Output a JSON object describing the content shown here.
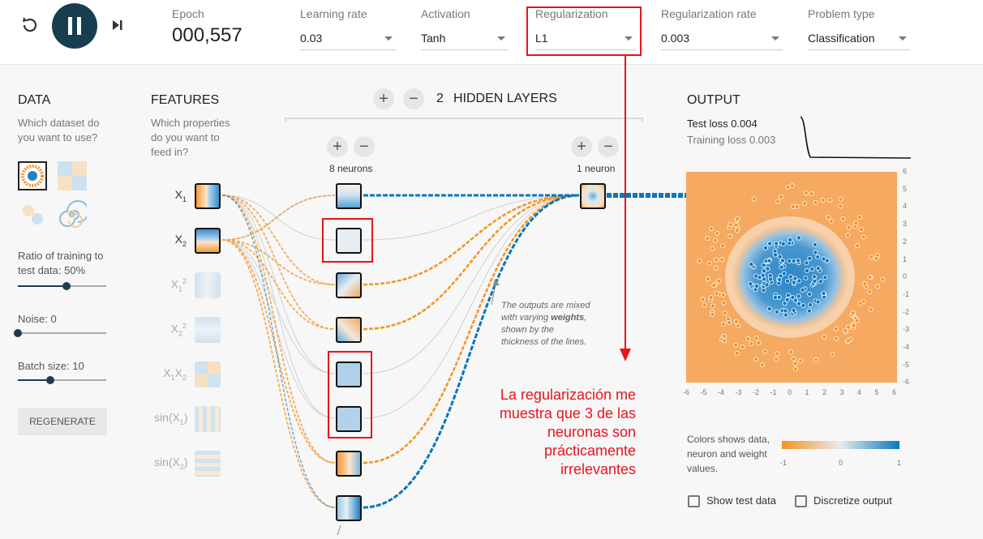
{
  "header": {
    "epoch_label": "Epoch",
    "epoch_value": "000,557",
    "learning_rate_label": "Learning rate",
    "learning_rate_value": "0.03",
    "activation_label": "Activation",
    "activation_value": "Tanh",
    "regularization_label": "Regularization",
    "regularization_value": "L1",
    "regularization_rate_label": "Regularization rate",
    "regularization_rate_value": "0.003",
    "problem_type_label": "Problem type",
    "problem_type_value": "Classification"
  },
  "data_panel": {
    "title": "DATA",
    "subtitle": "Which dataset do you want to use?",
    "ratio_label": "Ratio of training to test data:",
    "ratio_value": "50%",
    "ratio_fraction": 0.5,
    "noise_label": "Noise:",
    "noise_value": "0",
    "noise_fraction": 0.0,
    "batch_label": "Batch size:",
    "batch_value": "10",
    "batch_fraction": 0.32,
    "regenerate_label": "REGENERATE"
  },
  "features_panel": {
    "title": "FEATURES",
    "subtitle": "Which properties do you want to feed in?",
    "features": [
      {
        "label": "X1",
        "base": "X",
        "sub": "1",
        "sup": "",
        "active": true
      },
      {
        "label": "X2",
        "base": "X",
        "sub": "2",
        "sup": "",
        "active": true
      },
      {
        "label": "X1^2",
        "base": "X",
        "sub": "1",
        "sup": "2",
        "active": false
      },
      {
        "label": "X2^2",
        "base": "X",
        "sub": "2",
        "sup": "2",
        "active": false
      },
      {
        "label": "X1X2",
        "base": "X",
        "sub": "1",
        "sup": "",
        "active": false
      },
      {
        "label": "sin(X1)",
        "base": "sin(X",
        "sub": "1",
        "sup": "",
        "active": false
      },
      {
        "label": "sin(X2)",
        "base": "sin(X",
        "sub": "2",
        "sup": "",
        "active": false
      }
    ]
  },
  "network": {
    "hidden_layers_count": "2",
    "hidden_layers_label": "HIDDEN LAYERS",
    "plus_label": "+",
    "minus_label": "−",
    "layer1_neurons_label": "8 neurons",
    "layer2_neurons_label": "1 neuron",
    "annotation_prefix": "The outputs are mixed with varying ",
    "annotation_bold": "weights",
    "annotation_suffix": ", shown by the thickness of the lines."
  },
  "red_note": {
    "line1": "La regularización me",
    "line2": "muestra que 3 de las",
    "line3": "neuronas son",
    "line4": "prácticamente",
    "line5": "irrelevantes"
  },
  "output_panel": {
    "title": "OUTPUT",
    "test_loss_label": "Test loss",
    "test_loss_value": "0.004",
    "training_loss_label": "Training loss",
    "training_loss_value": "0.003",
    "axis_ticks": [
      "-6",
      "-5",
      "-4",
      "-3",
      "-2",
      "-1",
      "0",
      "1",
      "2",
      "3",
      "4",
      "5",
      "6"
    ],
    "legend_text": "Colors shows data, neuron and weight values.",
    "legend_min": "-1",
    "legend_mid": "0",
    "legend_max": "1",
    "show_test_data_label": "Show test data",
    "discretize_label": "Discretize output"
  },
  "colors": {
    "positive": "#0877bd",
    "negative": "#f59322",
    "annotation_red": "#e8141c",
    "button_dark": "#183d4e"
  }
}
